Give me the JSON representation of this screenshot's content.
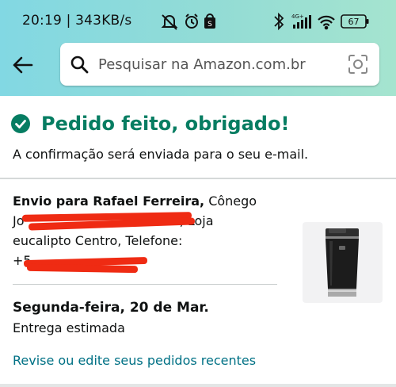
{
  "statusbar": {
    "time": "20:19",
    "speed": "| 343KB/s",
    "network_label": "4G+",
    "battery": "67",
    "icons": [
      "bell-off-icon",
      "alarm-icon",
      "shopping-bag-icon",
      "bluetooth-icon",
      "signal-icon",
      "wifi-icon",
      "battery-icon"
    ]
  },
  "header": {
    "search_placeholder": "Pesquisar na Amazon.com.br",
    "icons": [
      "back-arrow-icon",
      "search-icon",
      "camera-scan-icon"
    ],
    "background_colors": [
      "#82d8e3",
      "#a5e4cf"
    ]
  },
  "order": {
    "title": "Pedido feito, obrigado!",
    "confirmation": "A confirmação será enviada para o seu e-mail.",
    "shipping_label": "Envio para Rafael Ferreira,",
    "address_line1_tail": "Cônego",
    "address_line2_start": "Jo",
    "address_line2_end": "3, Loja",
    "address_line3": "eucalipto Centro, Telefone:",
    "address_line4_start": "+5",
    "delivery_date": "Segunda-feira, 20 de Mar.",
    "delivery_label": "Entrega estimada",
    "orders_link": "Revise ou edite seus pedidos recentes"
  },
  "product": {
    "image": "black-insulated-tumbler"
  },
  "colors": {
    "success_green": "#067d62",
    "link_teal": "#007185",
    "redaction": "#ef2b13"
  }
}
